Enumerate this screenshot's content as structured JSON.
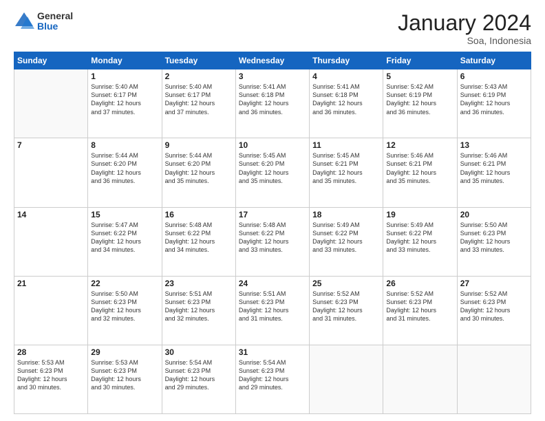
{
  "header": {
    "logo_line1": "General",
    "logo_line2": "Blue",
    "month": "January 2024",
    "location": "Soa, Indonesia"
  },
  "days_of_week": [
    "Sunday",
    "Monday",
    "Tuesday",
    "Wednesday",
    "Thursday",
    "Friday",
    "Saturday"
  ],
  "weeks": [
    [
      {
        "day": "",
        "info": ""
      },
      {
        "day": "1",
        "info": "Sunrise: 5:40 AM\nSunset: 6:17 PM\nDaylight: 12 hours\nand 37 minutes."
      },
      {
        "day": "2",
        "info": "Sunrise: 5:40 AM\nSunset: 6:17 PM\nDaylight: 12 hours\nand 37 minutes."
      },
      {
        "day": "3",
        "info": "Sunrise: 5:41 AM\nSunset: 6:18 PM\nDaylight: 12 hours\nand 36 minutes."
      },
      {
        "day": "4",
        "info": "Sunrise: 5:41 AM\nSunset: 6:18 PM\nDaylight: 12 hours\nand 36 minutes."
      },
      {
        "day": "5",
        "info": "Sunrise: 5:42 AM\nSunset: 6:19 PM\nDaylight: 12 hours\nand 36 minutes."
      },
      {
        "day": "6",
        "info": "Sunrise: 5:43 AM\nSunset: 6:19 PM\nDaylight: 12 hours\nand 36 minutes."
      }
    ],
    [
      {
        "day": "7",
        "info": ""
      },
      {
        "day": "8",
        "info": "Sunrise: 5:44 AM\nSunset: 6:20 PM\nDaylight: 12 hours\nand 36 minutes."
      },
      {
        "day": "9",
        "info": "Sunrise: 5:44 AM\nSunset: 6:20 PM\nDaylight: 12 hours\nand 35 minutes."
      },
      {
        "day": "10",
        "info": "Sunrise: 5:45 AM\nSunset: 6:20 PM\nDaylight: 12 hours\nand 35 minutes."
      },
      {
        "day": "11",
        "info": "Sunrise: 5:45 AM\nSunset: 6:21 PM\nDaylight: 12 hours\nand 35 minutes."
      },
      {
        "day": "12",
        "info": "Sunrise: 5:46 AM\nSunset: 6:21 PM\nDaylight: 12 hours\nand 35 minutes."
      },
      {
        "day": "13",
        "info": "Sunrise: 5:46 AM\nSunset: 6:21 PM\nDaylight: 12 hours\nand 35 minutes."
      }
    ],
    [
      {
        "day": "14",
        "info": ""
      },
      {
        "day": "15",
        "info": "Sunrise: 5:47 AM\nSunset: 6:22 PM\nDaylight: 12 hours\nand 34 minutes."
      },
      {
        "day": "16",
        "info": "Sunrise: 5:48 AM\nSunset: 6:22 PM\nDaylight: 12 hours\nand 34 minutes."
      },
      {
        "day": "17",
        "info": "Sunrise: 5:48 AM\nSunset: 6:22 PM\nDaylight: 12 hours\nand 33 minutes."
      },
      {
        "day": "18",
        "info": "Sunrise: 5:49 AM\nSunset: 6:22 PM\nDaylight: 12 hours\nand 33 minutes."
      },
      {
        "day": "19",
        "info": "Sunrise: 5:49 AM\nSunset: 6:22 PM\nDaylight: 12 hours\nand 33 minutes."
      },
      {
        "day": "20",
        "info": "Sunrise: 5:50 AM\nSunset: 6:23 PM\nDaylight: 12 hours\nand 33 minutes."
      }
    ],
    [
      {
        "day": "21",
        "info": ""
      },
      {
        "day": "22",
        "info": "Sunrise: 5:50 AM\nSunset: 6:23 PM\nDaylight: 12 hours\nand 32 minutes."
      },
      {
        "day": "23",
        "info": "Sunrise: 5:51 AM\nSunset: 6:23 PM\nDaylight: 12 hours\nand 32 minutes."
      },
      {
        "day": "24",
        "info": "Sunrise: 5:51 AM\nSunset: 6:23 PM\nDaylight: 12 hours\nand 31 minutes."
      },
      {
        "day": "25",
        "info": "Sunrise: 5:52 AM\nSunset: 6:23 PM\nDaylight: 12 hours\nand 31 minutes."
      },
      {
        "day": "26",
        "info": "Sunrise: 5:52 AM\nSunset: 6:23 PM\nDaylight: 12 hours\nand 31 minutes."
      },
      {
        "day": "27",
        "info": "Sunrise: 5:52 AM\nSunset: 6:23 PM\nDaylight: 12 hours\nand 30 minutes."
      }
    ],
    [
      {
        "day": "28",
        "info": "Sunrise: 5:53 AM\nSunset: 6:23 PM\nDaylight: 12 hours\nand 30 minutes."
      },
      {
        "day": "29",
        "info": "Sunrise: 5:53 AM\nSunset: 6:23 PM\nDaylight: 12 hours\nand 30 minutes."
      },
      {
        "day": "30",
        "info": "Sunrise: 5:54 AM\nSunset: 6:23 PM\nDaylight: 12 hours\nand 29 minutes."
      },
      {
        "day": "31",
        "info": "Sunrise: 5:54 AM\nSunset: 6:23 PM\nDaylight: 12 hours\nand 29 minutes."
      },
      {
        "day": "",
        "info": ""
      },
      {
        "day": "",
        "info": ""
      },
      {
        "day": "",
        "info": ""
      }
    ]
  ]
}
